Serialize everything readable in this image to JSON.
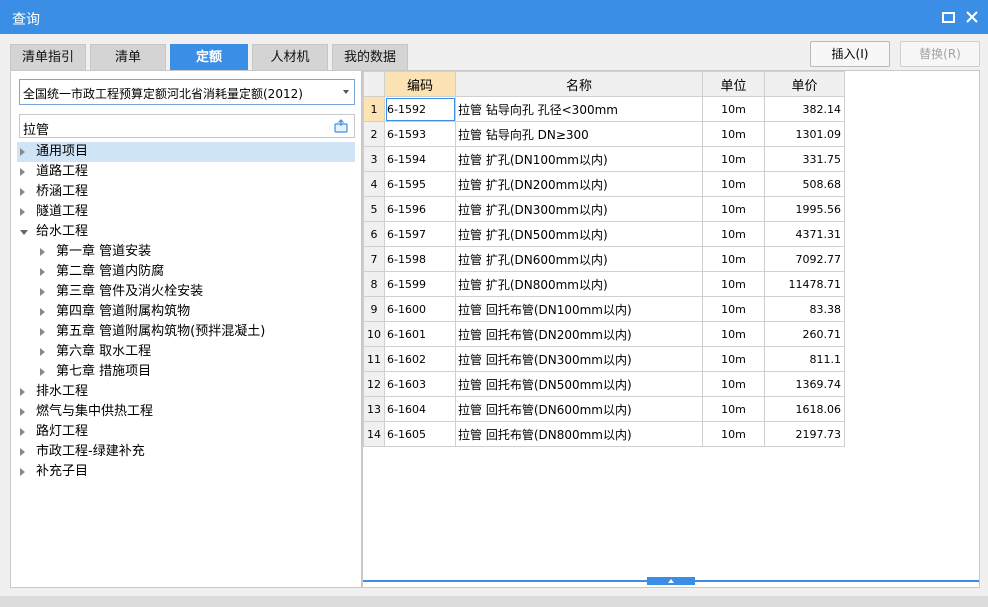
{
  "window": {
    "title": "查询"
  },
  "tabs": [
    {
      "label": "清单指引",
      "active": false
    },
    {
      "label": "清单",
      "active": false
    },
    {
      "label": "定额",
      "active": true
    },
    {
      "label": "人材机",
      "active": false
    },
    {
      "label": "我的数据",
      "active": false
    }
  ],
  "actions": {
    "insert_label": "插入(I)",
    "replace_label": "替换(R)"
  },
  "library": {
    "selected": "全国统一市政工程预算定额河北省消耗量定额(2012)"
  },
  "search": {
    "value": "拉管"
  },
  "tree": [
    {
      "label": "通用项目",
      "level": 0,
      "expanded": false,
      "selected": true
    },
    {
      "label": "道路工程",
      "level": 0,
      "expanded": false
    },
    {
      "label": "桥涵工程",
      "level": 0,
      "expanded": false
    },
    {
      "label": "隧道工程",
      "level": 0,
      "expanded": false
    },
    {
      "label": "给水工程",
      "level": 0,
      "expanded": true
    },
    {
      "label": "第一章 管道安装",
      "level": 1,
      "expanded": false
    },
    {
      "label": "第二章 管道内防腐",
      "level": 1,
      "expanded": false
    },
    {
      "label": "第三章 管件及消火栓安装",
      "level": 1,
      "expanded": false
    },
    {
      "label": "第四章 管道附属构筑物",
      "level": 1,
      "expanded": false
    },
    {
      "label": "第五章 管道附属构筑物(预拌混凝土)",
      "level": 1,
      "expanded": false
    },
    {
      "label": "第六章 取水工程",
      "level": 1,
      "expanded": false
    },
    {
      "label": "第七章 措施项目",
      "level": 1,
      "expanded": false
    },
    {
      "label": "排水工程",
      "level": 0,
      "expanded": false
    },
    {
      "label": "燃气与集中供热工程",
      "level": 0,
      "expanded": false
    },
    {
      "label": "路灯工程",
      "level": 0,
      "expanded": false
    },
    {
      "label": "市政工程-绿建补充",
      "level": 0,
      "expanded": false
    },
    {
      "label": "补充子目",
      "level": 0,
      "expanded": false
    }
  ],
  "grid": {
    "columns": [
      "编码",
      "名称",
      "单位",
      "单价"
    ],
    "rows": [
      {
        "n": "1",
        "code": "6-1592",
        "name": "拉管 钻导向孔 孔径<300mm",
        "unit": "10m",
        "price": "382.14"
      },
      {
        "n": "2",
        "code": "6-1593",
        "name": "拉管 钻导向孔 DN≥300",
        "unit": "10m",
        "price": "1301.09"
      },
      {
        "n": "3",
        "code": "6-1594",
        "name": "拉管 扩孔(DN100mm以内)",
        "unit": "10m",
        "price": "331.75"
      },
      {
        "n": "4",
        "code": "6-1595",
        "name": "拉管 扩孔(DN200mm以内)",
        "unit": "10m",
        "price": "508.68"
      },
      {
        "n": "5",
        "code": "6-1596",
        "name": "拉管 扩孔(DN300mm以内)",
        "unit": "10m",
        "price": "1995.56"
      },
      {
        "n": "6",
        "code": "6-1597",
        "name": "拉管 扩孔(DN500mm以内)",
        "unit": "10m",
        "price": "4371.31"
      },
      {
        "n": "7",
        "code": "6-1598",
        "name": "拉管 扩孔(DN600mm以内)",
        "unit": "10m",
        "price": "7092.77"
      },
      {
        "n": "8",
        "code": "6-1599",
        "name": "拉管 扩孔(DN800mm以内)",
        "unit": "10m",
        "price": "11478.71"
      },
      {
        "n": "9",
        "code": "6-1600",
        "name": "拉管 回托布管(DN100mm以内)",
        "unit": "10m",
        "price": "83.38"
      },
      {
        "n": "10",
        "code": "6-1601",
        "name": "拉管 回托布管(DN200mm以内)",
        "unit": "10m",
        "price": "260.71"
      },
      {
        "n": "11",
        "code": "6-1602",
        "name": "拉管 回托布管(DN300mm以内)",
        "unit": "10m",
        "price": "811.1"
      },
      {
        "n": "12",
        "code": "6-1603",
        "name": "拉管 回托布管(DN500mm以内)",
        "unit": "10m",
        "price": "1369.74"
      },
      {
        "n": "13",
        "code": "6-1604",
        "name": "拉管 回托布管(DN600mm以内)",
        "unit": "10m",
        "price": "1618.06"
      },
      {
        "n": "14",
        "code": "6-1605",
        "name": "拉管 回托布管(DN800mm以内)",
        "unit": "10m",
        "price": "2197.73"
      }
    ]
  },
  "colors": {
    "accent": "#3a8ee6",
    "highlight": "#fbe3b4",
    "selection": "#cfe4f7"
  }
}
